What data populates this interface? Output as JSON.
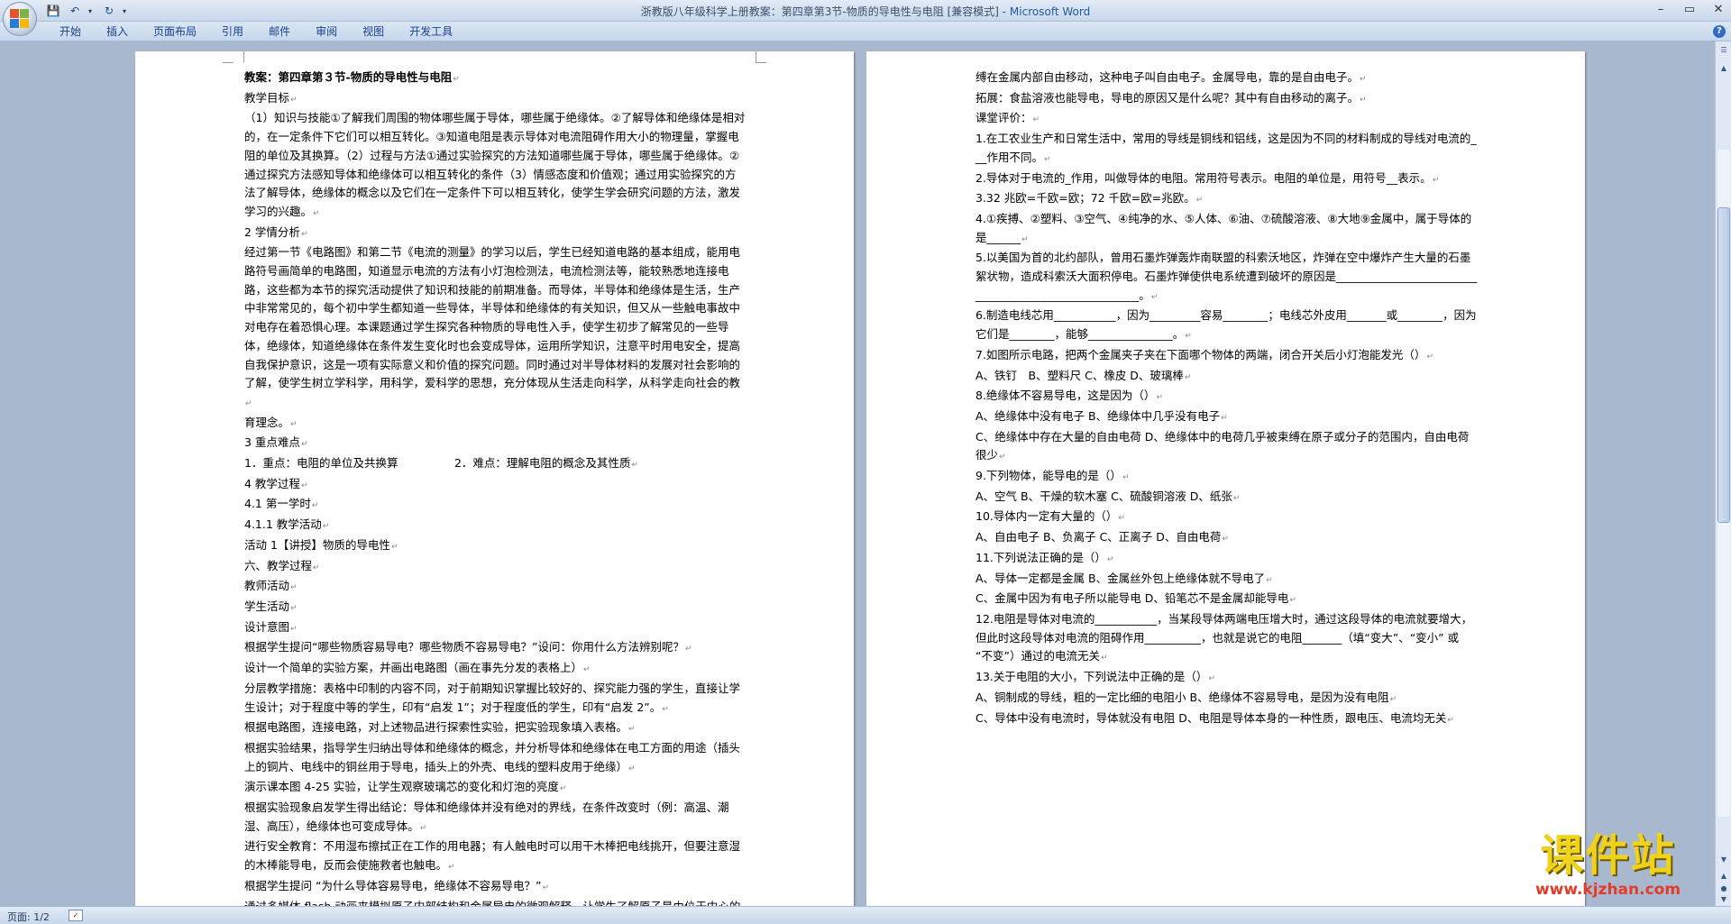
{
  "window": {
    "title": "浙教版八年级科学上册教案：第四章第3节-物质的导电性与电阻 [兼容模式]",
    "app_name": "Microsoft Word",
    "controls": [
      "–",
      "▭",
      "✕"
    ]
  },
  "ribbon": {
    "tabs": [
      "开始",
      "插入",
      "页面布局",
      "引用",
      "邮件",
      "审阅",
      "视图",
      "开发工具"
    ]
  },
  "status": {
    "page": "页面: 1/2"
  },
  "page1": {
    "lines": [
      "教案：第四章第３节-物质的导电性与电阻",
      "教学目标",
      "（1）知识与技能①了解我们周围的物体哪些属于导体，哪些属于绝缘体。②了解导体和绝缘体是相对的，在一定条件下它们可以相互转化。③知道电阻是表示导体对电流阻碍作用大小的物理量，掌握电阻的单位及其换算。（2）过程与方法①通过实验探究的方法知道哪些属于导体，哪些属于绝缘体。②通过探究方法感知导体和绝缘体可以相互转化的条件（3）情感态度和价值观；通过用实验探究的方法了解导体，绝缘体的概念以及它们在一定条件下可以相互转化，使学生学会研究问题的方法，激发学习的兴趣。",
      "2 学情分析",
      "经过第一节《电路图》和第二节《电流的测量》的学习以后，学生已经知道电路的基本组成，能用电路符号画简单的电路图，知道显示电流的方法有小灯泡检测法，电流检测法等，能较熟悉地连接电路，这些都为本节的探究活动提供了知识和技能的前期准备。而导体，半导体和绝缘体是生活，生产中非常常见的，每个初中学生都知道一些导体，半导体和绝缘体的有关知识，但又从一些触电事故中对电存在着恐惧心理。本课题通过学生探究各种物质的导电性入手，使学生初步了解常见的一些导体，绝缘体，知道绝缘体在条件发生变化时也会变成导体，运用所学知识，注意平时用电安全，提高自我保护意识，这是一项有实际意义和价值的探究问题。同时通过对半导体材料的发展对社会影响的了解，使学生树立学科学，用科学，爱科学的思想，充分体现从生活走向科学，从科学走向社会的教",
      "育理念。",
      "3 重点难点",
      "1．重点：电阻的单位及共换算　　　　　2．难点：理解电阻的概念及其性质",
      "4 教学过程",
      "4.1 第一学时",
      "4.1.1 教学活动",
      "活动 1【讲授】物质的导电性",
      "六、教学过程",
      "教师活动",
      "学生活动",
      "设计意图",
      "根据学生提问“哪些物质容易导电？哪些物质不容易导电？”设问：你用什么方法辨别呢？",
      "设计一个简单的实验方案，并画出电路图（画在事先分发的表格上）",
      "分层教学措施：表格中印制的内容不同，对于前期知识掌握比较好的、探究能力强的学生，直接让学生设计；对于程度中等的学生，印有“启发 1”；对于程度低的学生，印有“启发 2”。",
      "根据电路图，连接电路，对上述物品进行探索性实验，把实验现象填入表格。",
      "根据实验结果，指导学生归纳出导体和绝缘体的概念，并分析导体和绝缘体在电工方面的用途（插头上的铜片、电线中的铜丝用于导电，插头上的外壳、电线的塑料皮用于绝缘）",
      "演示课本图 4-25 实验，让学生观察玻璃芯的变化和灯泡的亮度",
      "根据实验现象启发学生得出结论：导体和绝缘体并没有绝对的界线，在条件改变时（例：高温、潮湿、高压），绝缘体也可变成导体。",
      "进行安全教育：不用湿布擦拭正在工作的用电器；有人触电时可以用干木棒把电线挑开，但要注意湿的木棒能导电，反而会使施救者也触电。",
      "根据学生提问 “为什么导体容易导电，绝缘体不容易导电？”",
      "通过多媒体 flash 动画来模拟原子内部结构和金属导电的微观解释，让学生了解原子是由位于中心的原子核和核外高速运动的电子构成，在金属导体中，部分电子可以脱离原子核的束"
    ]
  },
  "page2": {
    "lines": [
      "缚在金属内部自由移动，这种电子叫自由电子。金属导电，靠的是自由电子。",
      "拓展：食盐溶液也能导电，导电的原因又是什么呢？其中有自由移动的离子。",
      "课堂评价：",
      "1.在工农业生产和日常生活中，常用的导线是铜线和铝线，这是因为不同的材料制成的导线对电流的___作用不同。",
      "2.导体对于电流的_作用，叫做导体的电阻。常用符号表示。电阻的单位是，用符号__表示。",
      "3.32 兆欧=千欧=欧；72 千欧=欧=兆欧。",
      "4.①疾搏、②塑料、③空气、④纯净的水、⑤人体、⑥油、⑦硫酸溶液、⑧大地⑨金属中，属于导体的是______",
      "5.以美国为首的北约部队，曾用石墨炸弹轰炸南联盟的科索沃地区，炸弹在空中爆炸产生大量的石墨絮状物，造成科索沃大面积停电。石墨炸弹使供电系统遭到破坏的原因是______________________________________________________。",
      "6.制造电线芯用___________，因为_________容易________；电线芯外皮用_______或________，因为它们是________，能够_______________。",
      "7.如图所示电路，把两个金属夹子夹在下面哪个物体的两端，闭合开关后小灯泡能发光（）",
      "A、铁钉　B、塑料尺 C、橡皮 D、玻璃棒",
      "8.绝缘体不容易导电，这是因为（）",
      "A、绝缘体中没有电子 B、绝缘体中几乎没有电子",
      "C、绝缘体中存在大量的自由电荷 D、绝缘体中的电荷几乎被束缚在原子或分子的范围内，自由电荷很少",
      "9.下列物体，能导电的是（）",
      "A、空气 B、干燥的软木塞 C、硫酸铜溶液 D、纸张",
      "10.导体内一定有大量的（）",
      "A、自由电子 B、负离子 C、正离子 D、自由电荷",
      "11.下列说法正确的是（）",
      "A、导体一定都是金属 B、金属丝外包上绝缘体就不导电了",
      "C、金属中因为有电子所以能导电 D、铅笔芯不是金属却能导电",
      "12.电阻是导体对电流的___________，当某段导体两端电压增大时，通过这段导体的电流就要增大，但此时这段导体对电流的阻碍作用__________，也就是说它的电阻_______（填“变大”、“变小” 或 “不变”）通过的电流无关",
      "13.关于电阻的大小，下列说法中正确的是（）",
      "A、铜制成的导线，粗的一定比细的电阻小 B、绝缘体不容易导电，是因为没有电阻",
      "C、导体中没有电流时，导体就没有电阻 D、电阻是导体本身的一种性质，跟电压、电流均无关"
    ]
  },
  "watermark": {
    "title": "课件站",
    "url": "www.kjzhan.com"
  }
}
